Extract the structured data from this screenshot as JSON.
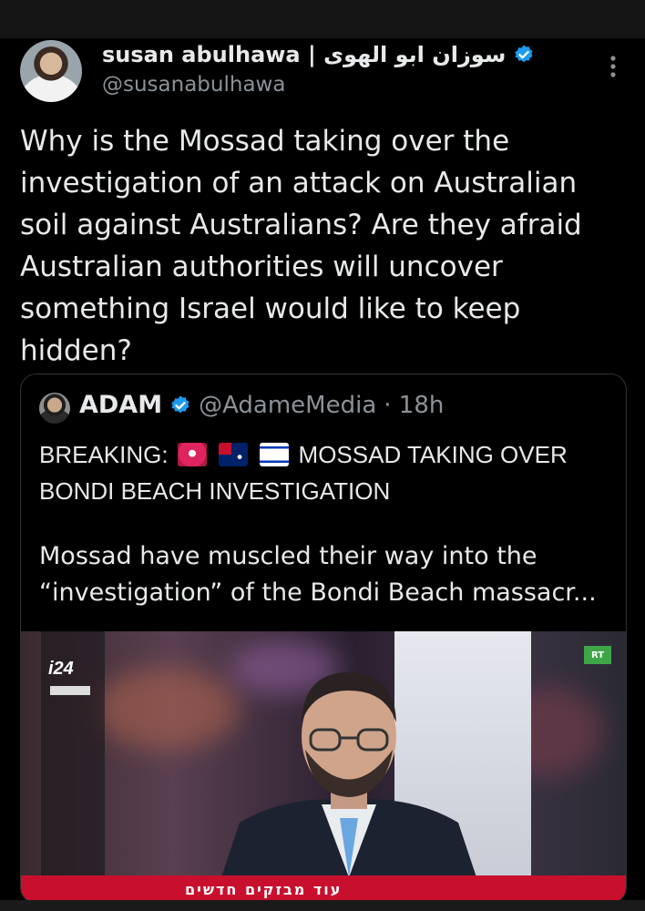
{
  "tweet": {
    "author_name": "susan abulhawa | سوزان ابو الهوى",
    "handle": "@susanabulhawa",
    "text": "Why is the Mossad taking over the investigation of an attack on Australian soil against Australians? Are they afraid Australian authorities will uncover something Israel would like to keep hidden?"
  },
  "quote": {
    "author_name": "ADAM",
    "handle": "@AdameMedia",
    "time": "· 18h",
    "breaking_prefix": "BREAKING:",
    "breaking_rest": "MOSSAD TAKING OVER BONDI BEACH INVESTIGATION",
    "body": "Mossad have muscled their way into the “investigation” of the Bondi Beach massacr...",
    "media": {
      "channel_logo": "i24",
      "rt_logo": "RT",
      "ticker": "עוד מבזקים חדשים"
    }
  },
  "icons": {
    "verified": "verified-badge-icon",
    "more": "more-vertical-icon",
    "emoji_siren": "siren-emoji",
    "emoji_au": "australia-flag-emoji",
    "emoji_il": "israel-flag-emoji"
  },
  "colors": {
    "background": "#000000",
    "text": "#e7e9ea",
    "muted": "#8b9298",
    "verified_blue": "#1d9bf0",
    "card_border": "#2f3336"
  }
}
